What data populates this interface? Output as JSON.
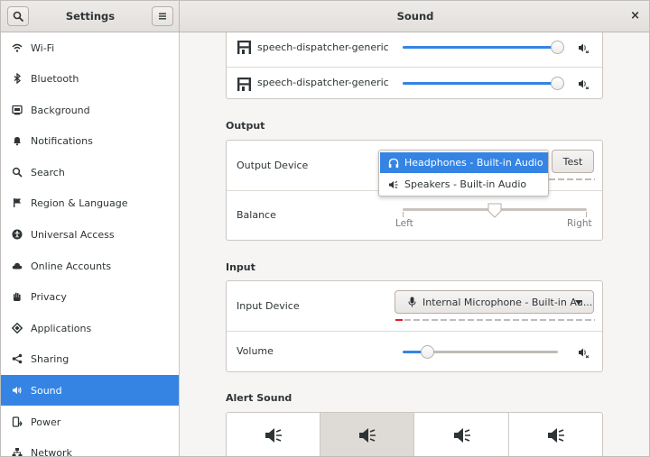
{
  "header": {
    "search_icon": "search-icon",
    "app_title": "Settings",
    "menu_icon": "hamburger-icon",
    "panel_title": "Sound",
    "close_glyph": "×"
  },
  "sidebar": {
    "items": [
      {
        "label": "Wi-Fi",
        "icon": "wifi-icon"
      },
      {
        "label": "Bluetooth",
        "icon": "bluetooth-icon"
      },
      {
        "label": "Background",
        "icon": "background-icon"
      },
      {
        "label": "Notifications",
        "icon": "bell-icon"
      },
      {
        "label": "Search",
        "icon": "search-icon"
      },
      {
        "label": "Region & Language",
        "icon": "flag-icon"
      },
      {
        "label": "Universal Access",
        "icon": "accessibility-icon"
      },
      {
        "label": "Online Accounts",
        "icon": "cloud-icon"
      },
      {
        "label": "Privacy",
        "icon": "hand-icon"
      },
      {
        "label": "Applications",
        "icon": "applications-icon"
      },
      {
        "label": "Sharing",
        "icon": "share-icon"
      },
      {
        "label": "Sound",
        "icon": "speaker-icon"
      },
      {
        "label": "Power",
        "icon": "power-icon"
      },
      {
        "label": "Network",
        "icon": "network-icon"
      }
    ],
    "active_index": 11
  },
  "apps": {
    "rows": [
      {
        "name": "speech-dispatcher-generic",
        "level": 0.97
      },
      {
        "name": "speech-dispatcher-generic",
        "level": 0.97
      }
    ]
  },
  "output": {
    "title": "Output",
    "device_label": "Output Device",
    "test_label": "Test",
    "balance_label": "Balance",
    "balance_left": "Left",
    "balance_right": "Right",
    "balance_value": 0.5,
    "options": [
      {
        "label": "Headphones - Built-in Audio",
        "icon": "headphones-icon",
        "selected": true
      },
      {
        "label": "Speakers - Built-in Audio",
        "icon": "speaker-icon",
        "selected": false
      }
    ]
  },
  "input": {
    "title": "Input",
    "device_label": "Input Device",
    "device_value": "Internal Microphone - Built-in Au...",
    "volume_label": "Volume",
    "volume_level": 0.16
  },
  "alert": {
    "title": "Alert Sound",
    "tiles": [
      {
        "icon": "speaker-icon",
        "selected": false
      },
      {
        "icon": "speaker-icon",
        "selected": true
      },
      {
        "icon": "speaker-icon",
        "selected": false
      },
      {
        "icon": "speaker-icon",
        "selected": false
      }
    ]
  },
  "colors": {
    "accent": "#3584e4",
    "level_meter_red": "#e01b24"
  }
}
